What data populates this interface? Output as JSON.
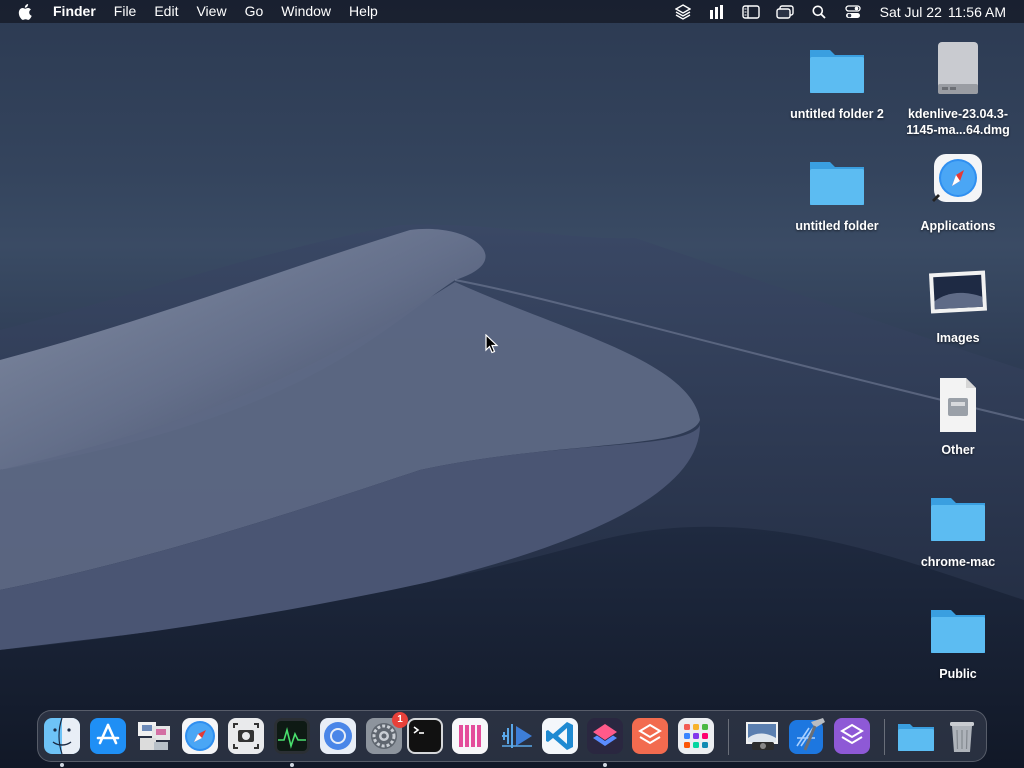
{
  "menubar": {
    "app_name": "Finder",
    "menus": [
      "File",
      "Edit",
      "View",
      "Go",
      "Window",
      "Help"
    ],
    "status_icons": [
      "layers-icon",
      "stats-icon",
      "sidebar-icon",
      "windows-icon",
      "search-icon",
      "control-center-icon"
    ],
    "date": "Sat Jul 22",
    "time": "11:56 AM"
  },
  "desktop_icons": [
    {
      "label": "untitled folder 2",
      "icon": "folder-icon"
    },
    {
      "label": "kdenlive-23.04.3-1145-ma...64.dmg",
      "icon": "disk-image-icon"
    },
    {
      "label": "untitled folder",
      "icon": "folder-icon"
    },
    {
      "label": "Applications",
      "icon": "safari-alias-icon"
    },
    {
      "label": "Images",
      "icon": "photo-icon"
    },
    {
      "label": "Other",
      "icon": "document-icon"
    },
    {
      "label": "chrome-mac",
      "icon": "folder-icon"
    },
    {
      "label": "Public",
      "icon": "folder-icon"
    }
  ],
  "dock": {
    "apps": [
      {
        "name": "Finder",
        "icon": "finder-icon",
        "running": true
      },
      {
        "name": "App Store",
        "icon": "app-store-icon",
        "running": false
      },
      {
        "name": "Preview",
        "icon": "preview-icon",
        "running": false
      },
      {
        "name": "Safari",
        "icon": "safari-icon",
        "running": false
      },
      {
        "name": "Screenshot",
        "icon": "screenshot-icon",
        "running": false
      },
      {
        "name": "Activity Monitor",
        "icon": "activity-monitor-icon",
        "running": true
      },
      {
        "name": "Chromium",
        "icon": "chromium-icon",
        "running": false
      },
      {
        "name": "System Settings",
        "icon": "settings-icon",
        "running": false,
        "badge": "1"
      },
      {
        "name": "Terminal",
        "icon": "terminal-icon",
        "running": false
      },
      {
        "name": "Columns",
        "icon": "columns-icon",
        "running": false
      },
      {
        "name": "Kdenlive",
        "icon": "kdenlive-icon",
        "running": false
      },
      {
        "name": "Visual Studio Code",
        "icon": "vscode-icon",
        "running": false
      },
      {
        "name": "Shortcuts",
        "icon": "shortcuts-icon",
        "running": true
      },
      {
        "name": "Affinity",
        "icon": "layers-app-icon",
        "running": false
      },
      {
        "name": "Launchpad",
        "icon": "launchpad-icon",
        "running": false
      },
      {
        "name": "Preview Image",
        "icon": "photos-viewer-icon",
        "running": false
      },
      {
        "name": "Xcode",
        "icon": "xcode-icon",
        "running": false
      },
      {
        "name": "Affinity Designer",
        "icon": "layers-purple-icon",
        "running": false
      },
      {
        "name": "Downloads",
        "icon": "folder-icon",
        "running": false
      },
      {
        "name": "Trash",
        "icon": "trash-icon",
        "running": false
      }
    ]
  },
  "colors": {
    "folder": "#4fb3ee",
    "badge": "#e8413a",
    "menubar": "#141a26"
  }
}
